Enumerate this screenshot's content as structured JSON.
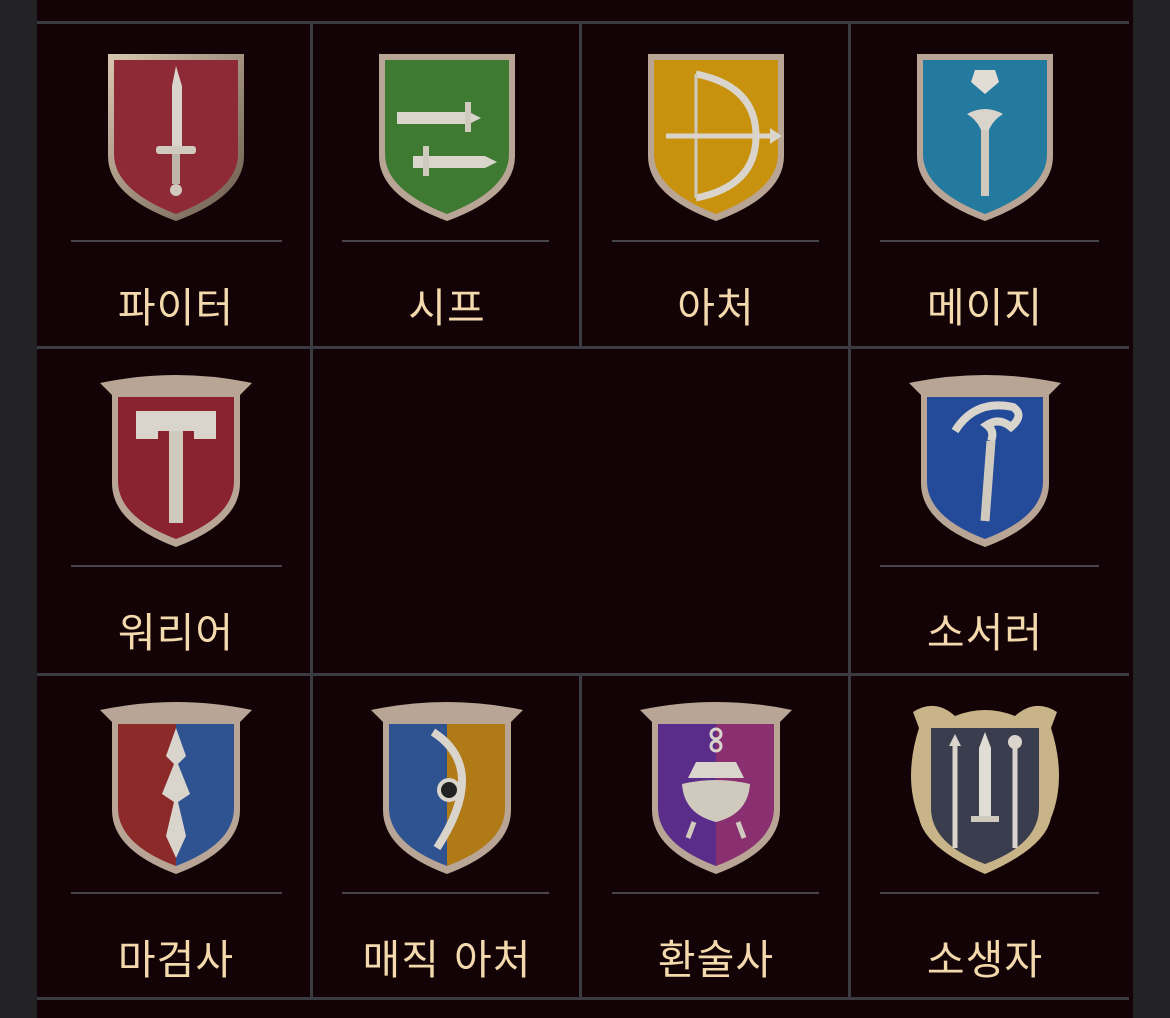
{
  "classes": [
    {
      "label": "파이터",
      "icon": "fighter-crest-icon",
      "colors": [
        "#8e2a35"
      ]
    },
    {
      "label": "시프",
      "icon": "thief-crest-icon",
      "colors": [
        "#3f7a33"
      ]
    },
    {
      "label": "아처",
      "icon": "archer-crest-icon",
      "colors": [
        "#c8920f"
      ]
    },
    {
      "label": "메이지",
      "icon": "mage-crest-icon",
      "colors": [
        "#237a9e"
      ]
    },
    {
      "label": "워리어",
      "icon": "warrior-crest-icon",
      "colors": [
        "#8a232e"
      ]
    },
    {
      "label": "소서러",
      "icon": "sorcerer-crest-icon",
      "colors": [
        "#244a9a"
      ]
    },
    {
      "label": "마검사",
      "icon": "magic-swordsman-crest-icon",
      "colors": [
        "#8c2a2a",
        "#2f5390"
      ]
    },
    {
      "label": "매직 아처",
      "icon": "magic-archer-crest-icon",
      "colors": [
        "#2f5390",
        "#b07a16"
      ]
    },
    {
      "label": "환술사",
      "icon": "illusionist-crest-icon",
      "colors": [
        "#5a2d8a",
        "#8a2f70"
      ]
    },
    {
      "label": "소생자",
      "icon": "reviver-crest-icon",
      "colors": [
        "#3a3d4e"
      ]
    }
  ],
  "theme": {
    "panel_bg": "#130307",
    "label_color": "#f3d9ac",
    "grid_line": "#3b3c42"
  }
}
